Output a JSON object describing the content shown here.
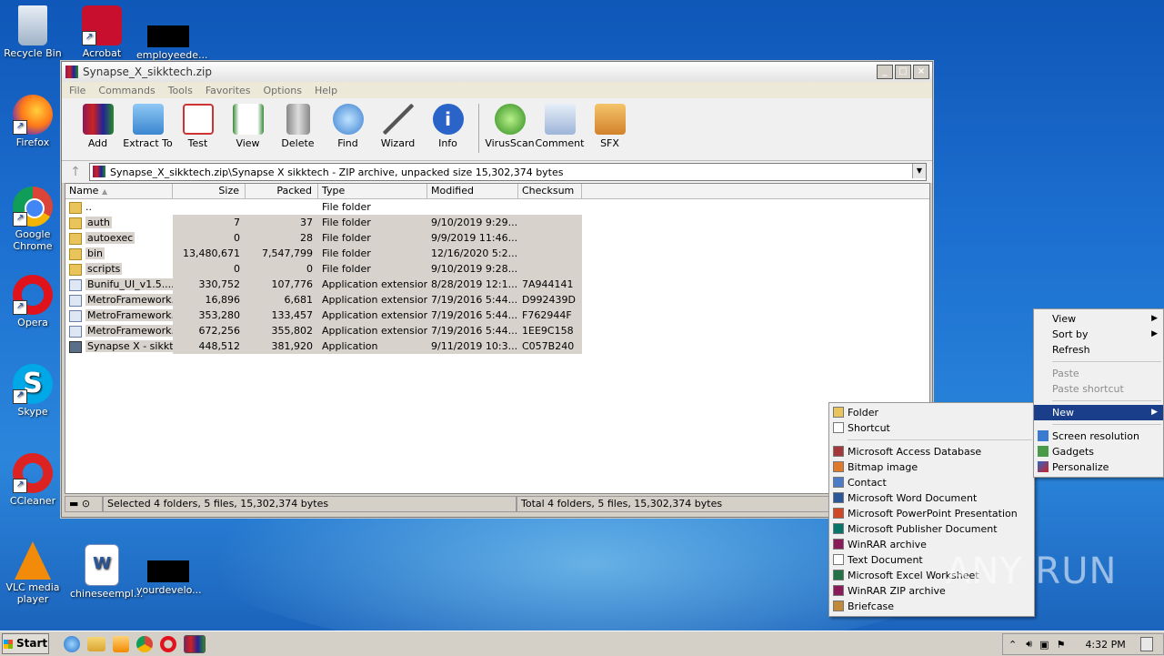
{
  "desktop": {
    "icons": [
      {
        "label": "Recycle Bin"
      },
      {
        "label": "Acrobat"
      },
      {
        "label": "employeede..."
      },
      {
        "label": "Firefox"
      },
      {
        "label": "Google Chrome"
      },
      {
        "label": "Opera"
      },
      {
        "label": "Skype"
      },
      {
        "label": "CCleaner"
      },
      {
        "label": "VLC media player"
      },
      {
        "label": "chineseempl..."
      },
      {
        "label": "yourdevelo..."
      }
    ]
  },
  "window": {
    "title": "Synapse_X_sikktech.zip",
    "controls": {
      "minimize": "_",
      "maximize": "□",
      "close": "×"
    },
    "menu": [
      "File",
      "Commands",
      "Tools",
      "Favorites",
      "Options",
      "Help"
    ],
    "toolbar": [
      "Add",
      "Extract To",
      "Test",
      "View",
      "Delete",
      "Find",
      "Wizard",
      "Info",
      "VirusScan",
      "Comment",
      "SFX"
    ],
    "address": "Synapse_X_sikktech.zip\\Synapse X sikktech - ZIP archive, unpacked size 15,302,374 bytes",
    "columns": [
      "Name",
      "Size",
      "Packed",
      "Type",
      "Modified",
      "Checksum"
    ],
    "rows": [
      {
        "name": "..",
        "size": "",
        "packed": "",
        "type": "File folder",
        "modified": "",
        "checksum": "",
        "icon": "folder",
        "selected": false
      },
      {
        "name": "auth",
        "size": "7",
        "packed": "37",
        "type": "File folder",
        "modified": "9/10/2019 9:29...",
        "checksum": "",
        "icon": "folder",
        "selected": true
      },
      {
        "name": "autoexec",
        "size": "0",
        "packed": "28",
        "type": "File folder",
        "modified": "9/9/2019 11:46...",
        "checksum": "",
        "icon": "folder",
        "selected": true
      },
      {
        "name": "bin",
        "size": "13,480,671",
        "packed": "7,547,799",
        "type": "File folder",
        "modified": "12/16/2020 5:2...",
        "checksum": "",
        "icon": "folder",
        "selected": true
      },
      {
        "name": "scripts",
        "size": "0",
        "packed": "0",
        "type": "File folder",
        "modified": "9/10/2019 9:28...",
        "checksum": "",
        "icon": "folder",
        "selected": true
      },
      {
        "name": "Bunifu_UI_v1.5....",
        "size": "330,752",
        "packed": "107,776",
        "type": "Application extension",
        "modified": "8/28/2019 12:1...",
        "checksum": "7A944141",
        "icon": "dll",
        "selected": true
      },
      {
        "name": "MetroFramework...",
        "size": "16,896",
        "packed": "6,681",
        "type": "Application extension",
        "modified": "7/19/2016 5:44...",
        "checksum": "D992439D",
        "icon": "dll",
        "selected": true
      },
      {
        "name": "MetroFramework...",
        "size": "353,280",
        "packed": "133,457",
        "type": "Application extension",
        "modified": "7/19/2016 5:44...",
        "checksum": "F762944F",
        "icon": "dll",
        "selected": true
      },
      {
        "name": "MetroFramework...",
        "size": "672,256",
        "packed": "355,802",
        "type": "Application extension",
        "modified": "7/19/2016 5:44...",
        "checksum": "1EE9C158",
        "icon": "dll",
        "selected": true
      },
      {
        "name": "Synapse X - sikkt...",
        "size": "448,512",
        "packed": "381,920",
        "type": "Application",
        "modified": "9/11/2019 10:3...",
        "checksum": "C057B240",
        "icon": "app",
        "selected": true
      }
    ],
    "status_left": "Selected 4 folders, 5 files, 15,302,374 bytes",
    "status_right": "Total 4 folders, 5 files, 15,302,374 bytes"
  },
  "context_menu": {
    "items": [
      {
        "label": "View",
        "submenu": true,
        "disabled": false
      },
      {
        "label": "Sort by",
        "submenu": true,
        "disabled": false
      },
      {
        "label": "Refresh",
        "submenu": false,
        "disabled": false
      },
      {
        "label": "Paste",
        "submenu": false,
        "disabled": true
      },
      {
        "label": "Paste shortcut",
        "submenu": false,
        "disabled": true
      },
      {
        "label": "New",
        "submenu": true,
        "disabled": false,
        "highlighted": true
      },
      {
        "label": "Screen resolution",
        "submenu": false,
        "disabled": false
      },
      {
        "label": "Gadgets",
        "submenu": false,
        "disabled": false
      },
      {
        "label": "Personalize",
        "submenu": false,
        "disabled": false
      }
    ]
  },
  "new_submenu": {
    "items": [
      {
        "label": "Folder",
        "icon": "folder-icon"
      },
      {
        "label": "Shortcut",
        "icon": "shortcut-icon"
      },
      {
        "label": "Microsoft Access Database",
        "icon": "access-icon"
      },
      {
        "label": "Bitmap image",
        "icon": "bitmap-icon"
      },
      {
        "label": "Contact",
        "icon": "contact-icon"
      },
      {
        "label": "Microsoft Word Document",
        "icon": "word-icon"
      },
      {
        "label": "Microsoft PowerPoint Presentation",
        "icon": "powerpoint-icon"
      },
      {
        "label": "Microsoft Publisher Document",
        "icon": "publisher-icon"
      },
      {
        "label": "WinRAR archive",
        "icon": "winrar-icon"
      },
      {
        "label": "Text Document",
        "icon": "text-icon"
      },
      {
        "label": "Microsoft Excel Worksheet",
        "icon": "excel-icon"
      },
      {
        "label": "WinRAR ZIP archive",
        "icon": "winrar-zip-icon"
      },
      {
        "label": "Briefcase",
        "icon": "briefcase-icon"
      }
    ]
  },
  "taskbar": {
    "start_label": "Start",
    "clock": "4:32 PM"
  },
  "watermark": "ANY RUN"
}
